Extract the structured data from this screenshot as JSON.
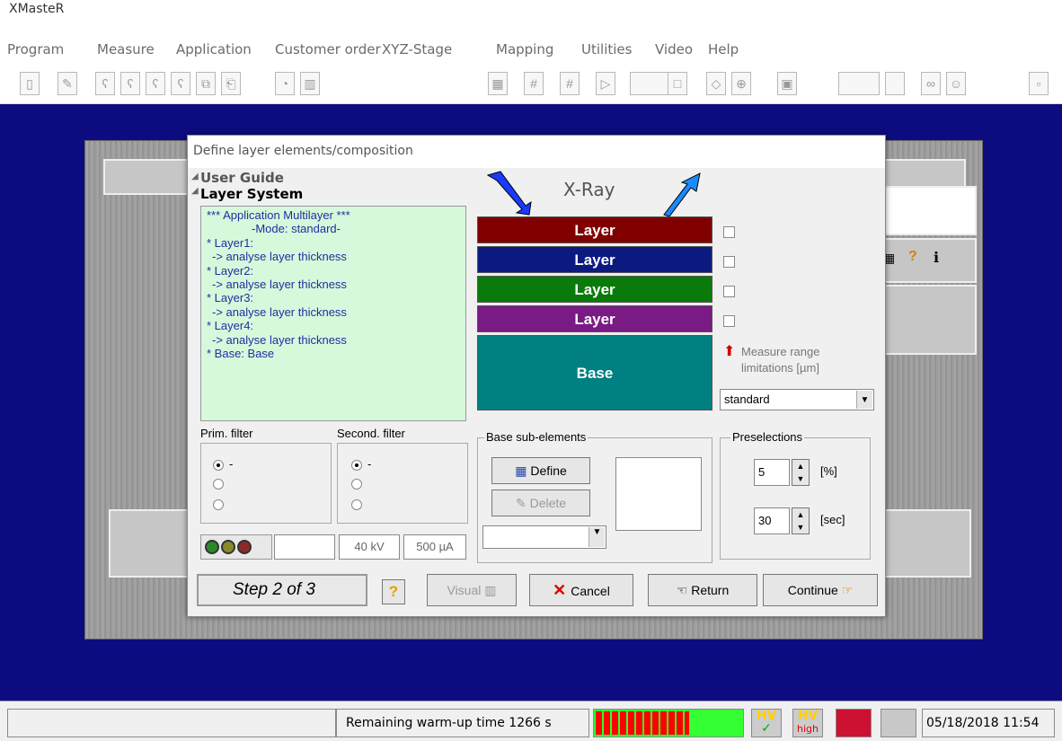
{
  "app": {
    "title": "XMasteR"
  },
  "menu": [
    "Program",
    "Measure",
    "Application",
    "Customer order",
    "XYZ-Stage",
    "Mapping",
    "Utilities",
    "Video",
    "Help"
  ],
  "dialog": {
    "title": "Define layer elements/composition",
    "tree": {
      "user_guide": "User Guide",
      "layer_system": "Layer System"
    },
    "guide_lines": [
      "*** Application Multilayer ***",
      "        -Mode: standard-",
      "* Layer1:",
      "  -> analyse layer thickness",
      "* Layer2:",
      "  -> analyse layer thickness",
      "* Layer3:",
      "  -> analyse layer thickness",
      "* Layer4:",
      "  -> analyse layer thickness",
      "* Base: Base"
    ],
    "xray_label": "X-Ray",
    "layers": [
      {
        "label": "Layer",
        "color": "#800000"
      },
      {
        "label": "Layer",
        "color": "#0c1a80"
      },
      {
        "label": "Layer",
        "color": "#0a7a0a"
      },
      {
        "label": "Layer",
        "color": "#7a1a85"
      }
    ],
    "base": {
      "label": "Base",
      "color": "#008080"
    },
    "measure_range": "Measure range limitations [µm]",
    "standard_select": "standard",
    "prim_filter": {
      "label": "Prim. filter",
      "options": [
        "-",
        "",
        ""
      ]
    },
    "second_filter": {
      "label": "Second. filter",
      "options": [
        "-",
        "",
        ""
      ]
    },
    "kv": "40 kV",
    "ua": "500 µA",
    "base_sub": {
      "label": "Base sub-elements",
      "define": "Define",
      "delete": "Delete"
    },
    "preselections": {
      "label": "Preselections",
      "value1": "5",
      "unit1": "[%]",
      "value2": "30",
      "unit2": "[sec]"
    },
    "step": "Step 2 of 3",
    "help_q": "?",
    "visual": "Visual",
    "cancel": "Cancel",
    "return": "Return",
    "continue": "Continue"
  },
  "status": {
    "warmup": "Remaining warm-up time 1266 s",
    "hv1": "HV",
    "hv2": "HV",
    "hv2_sub": "high",
    "datetime": "05/18/2018 11:54"
  },
  "colors": {
    "workspace": "#0c0c80",
    "guide_bg": "#d6f9dc",
    "progress_red": "#ff0000",
    "progress_green": "#33ff33"
  }
}
